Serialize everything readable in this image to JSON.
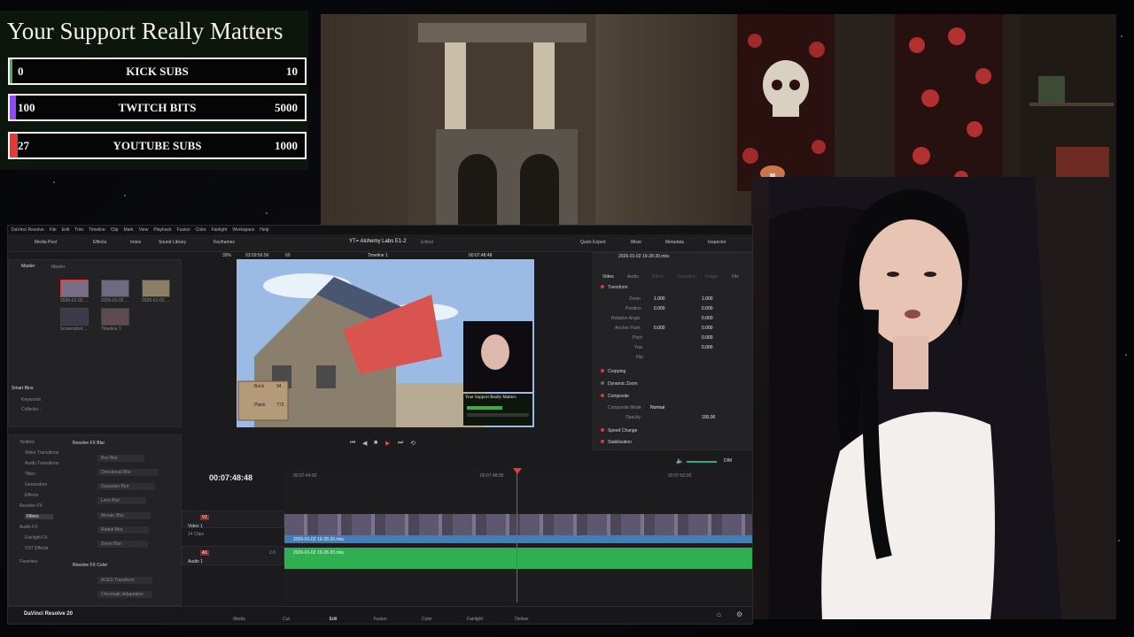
{
  "overlay": {
    "title": "Your Support Really Matters",
    "goals": [
      {
        "min": "0",
        "label": "KICK SUBS",
        "max": "10",
        "progress": 0.0,
        "color": "#4caf50"
      },
      {
        "min": "100",
        "label": "TWITCH BITS",
        "max": "5000",
        "progress": 0.02,
        "color": "#9146ff"
      },
      {
        "min": "27",
        "label": "YOUTUBE SUBS",
        "max": "1000",
        "progress": 0.027,
        "color": "#e53935"
      }
    ]
  },
  "app": {
    "name": "DaVinci Resolve",
    "menu": [
      "DaVinci Resolve",
      "File",
      "Edit",
      "Trim",
      "Timeline",
      "Clip",
      "Mark",
      "View",
      "Playback",
      "Fusion",
      "Color",
      "Fairlight",
      "Workspace",
      "Help"
    ],
    "toolbar": {
      "media_pool": "Media Pool",
      "effects": "Effects",
      "index": "Index",
      "sound_library": "Sound Library",
      "keyframes": "Keyframes",
      "project_title": "YT= Alchemy Labs E1-2",
      "edited": "Edited",
      "quick_export": "Quick Export",
      "mixer": "Mixer",
      "metadata": "Metadata",
      "inspector": "Inspector"
    },
    "media_pool": {
      "bin_master": "Master",
      "tab_master": "Master",
      "clips": [
        {
          "name": "2026-01-02 ..."
        },
        {
          "name": "2026-01-02 ..."
        },
        {
          "name": "2026-01-02 ..."
        },
        {
          "name": "Screenshot ..."
        },
        {
          "name": "Timeline 1"
        }
      ],
      "smart_bins": "Smart Bins",
      "smart_items": [
        "Keywords",
        "Collectio..."
      ]
    },
    "viewer": {
      "zoom": "39%",
      "timecode_left": "03:59:56:56",
      "fps": "60",
      "timeline_name": "Timeline 1",
      "timecode_right": "00:07:48:48",
      "clip_name": "2026-01-02 19-28-30.mkv",
      "hud_brick": "Brick",
      "hud_plank": "Plank",
      "hud_brick_count": "94",
      "hud_plank_count": "773",
      "hud_support": "Your Support Really Matters"
    },
    "inspector": {
      "tabs": [
        "Video",
        "Audio",
        "Effect",
        "Transition",
        "Image",
        "File"
      ],
      "transform": "Transform",
      "zoom_label": "Zoom",
      "zoom_x": "1.000",
      "zoom_y": "1.000",
      "position_label": "Position",
      "position_x": "0.000",
      "position_y": "0.000",
      "rotation_label": "Rotation Angle",
      "rotation_val": "0.000",
      "anchor_label": "Anchor Point",
      "anchor_x": "0.000",
      "anchor_y": "0.000",
      "pitch_label": "Pitch",
      "pitch_val": "0.000",
      "yaw_label": "Yaw",
      "yaw_val": "0.000",
      "flip_label": "Flip",
      "cropping": "Cropping",
      "dynamic_zoom": "Dynamic Zoom",
      "composite": "Composite",
      "composite_mode_label": "Composite Mode",
      "composite_mode_val": "Normal",
      "opacity_label": "Opacity",
      "opacity_val": "100.00",
      "speed_change": "Speed Change",
      "stabilization": "Stabilization"
    },
    "effects": {
      "toolbox": "Toolbox",
      "items": [
        "Video Transitions",
        "Audio Transitions",
        "Titles",
        "Generators",
        "Effects",
        "Resolve FX",
        "Filters",
        "Audio FX",
        "Fairlight FX",
        "VST Effects",
        "Favorites"
      ],
      "blur_header": "Resolve FX Blur",
      "blur_items": [
        "Box Blur",
        "Directional Blur",
        "Gaussian Blur",
        "Lens Blur",
        "Mosaic Blur",
        "Radial Blur",
        "Zoom Blur"
      ],
      "color_header": "Resolve FX Color",
      "color_items": [
        "ACES Transform",
        "Chromatic Adaptation"
      ]
    },
    "timeline": {
      "timecode": "00:07:48:48",
      "ruler": [
        "00:07:44:00",
        "00:07:48:00",
        "00:07:52:00"
      ],
      "v1": "V1",
      "v1_name": "Video 1",
      "v1_clips": "14 Clips",
      "a1": "A1",
      "a1_name": "Audio 1",
      "a1_level": "2.0",
      "video_clip": "2026-01-02 19-28-30.mkv",
      "audio_clip": "2026-01-02 19-28-30.mkv",
      "dim": "DIM"
    },
    "pages": [
      "Media",
      "Cut",
      "Edit",
      "Fusion",
      "Color",
      "Fairlight",
      "Deliver"
    ],
    "active_page": "Edit",
    "footer_brand": "DaVinci Resolve 20"
  }
}
